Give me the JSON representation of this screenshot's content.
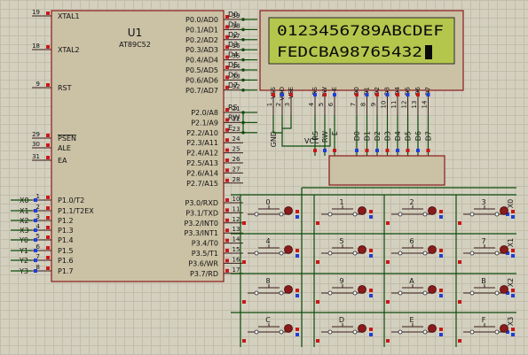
{
  "mcu": {
    "name": "U1",
    "part": "AT89C52",
    "left_pins": [
      {
        "num": "19",
        "name": "XTAL1",
        "net": ""
      },
      {
        "num": "18",
        "name": "XTAL2",
        "net": ""
      },
      {
        "num": "9",
        "name": "RST",
        "net": ""
      },
      {
        "num": "29",
        "name": "PSEN",
        "net": ""
      },
      {
        "num": "30",
        "name": "ALE",
        "net": ""
      },
      {
        "num": "31",
        "name": "EA",
        "net": ""
      },
      {
        "num": "1",
        "name": "P1.0/T2",
        "net": "X0"
      },
      {
        "num": "2",
        "name": "P1.1/T2EX",
        "net": "X1"
      },
      {
        "num": "3",
        "name": "P1.2",
        "net": "X2"
      },
      {
        "num": "4",
        "name": "P1.3",
        "net": "X3"
      },
      {
        "num": "5",
        "name": "P1.4",
        "net": "Y0"
      },
      {
        "num": "6",
        "name": "P1.5",
        "net": "Y1"
      },
      {
        "num": "7",
        "name": "P1.6",
        "net": "Y2"
      },
      {
        "num": "8",
        "name": "P1.7",
        "net": "Y3"
      }
    ],
    "right_pins": [
      {
        "num": "39",
        "name": "P0.0/AD0",
        "net": "D0"
      },
      {
        "num": "38",
        "name": "P0.1/AD1",
        "net": "D1"
      },
      {
        "num": "37",
        "name": "P0.2/AD2",
        "net": "D2"
      },
      {
        "num": "36",
        "name": "P0.3/AD3",
        "net": "D3"
      },
      {
        "num": "35",
        "name": "P0.4/AD4",
        "net": "D4"
      },
      {
        "num": "34",
        "name": "P0.5/AD5",
        "net": "D5"
      },
      {
        "num": "33",
        "name": "P0.6/AD6",
        "net": "D6"
      },
      {
        "num": "32",
        "name": "P0.7/AD7",
        "net": "D7"
      },
      {
        "num": "21",
        "name": "P2.0/A8",
        "net": "RS"
      },
      {
        "num": "22",
        "name": "P2.1/A9",
        "net": "RW"
      },
      {
        "num": "23",
        "name": "P2.2/A10",
        "net": "E"
      },
      {
        "num": "24",
        "name": "P2.3/A11",
        "net": ""
      },
      {
        "num": "25",
        "name": "P2.4/A12",
        "net": ""
      },
      {
        "num": "26",
        "name": "P2.5/A13",
        "net": ""
      },
      {
        "num": "27",
        "name": "P2.6/A14",
        "net": ""
      },
      {
        "num": "28",
        "name": "P2.7/A15",
        "net": ""
      },
      {
        "num": "10",
        "name": "P3.0/RXD",
        "net": ""
      },
      {
        "num": "11",
        "name": "P3.1/TXD",
        "net": ""
      },
      {
        "num": "12",
        "name": "P3.2/INT0",
        "net": ""
      },
      {
        "num": "13",
        "name": "P3.3/INT1",
        "net": ""
      },
      {
        "num": "14",
        "name": "P3.4/T0",
        "net": ""
      },
      {
        "num": "15",
        "name": "P3.5/T1",
        "net": ""
      },
      {
        "num": "16",
        "name": "P3.6/WR",
        "net": ""
      },
      {
        "num": "17",
        "name": "P3.7/RD",
        "net": ""
      }
    ]
  },
  "lcd": {
    "line1": "0123456789ABCDEF",
    "line2": "FEDCBA98765432",
    "pins": [
      {
        "name": "VSS",
        "num": "1"
      },
      {
        "name": "VDD",
        "num": "2"
      },
      {
        "name": "VEE",
        "num": "3"
      },
      {
        "name": "RS",
        "num": "4"
      },
      {
        "name": "RW",
        "num": "5"
      },
      {
        "name": "E",
        "num": "6"
      },
      {
        "name": "D0",
        "num": "7"
      },
      {
        "name": "D1",
        "num": "8"
      },
      {
        "name": "D2",
        "num": "9"
      },
      {
        "name": "D3",
        "num": "10"
      },
      {
        "name": "D4",
        "num": "11"
      },
      {
        "name": "D5",
        "num": "12"
      },
      {
        "name": "D6",
        "num": "13"
      },
      {
        "name": "D7",
        "num": "14"
      }
    ],
    "nets": [
      "GND",
      "",
      "",
      "RS",
      "RW",
      "E",
      "D0",
      "D1",
      "D2",
      "D3",
      "D4",
      "D5",
      "D6",
      "D7"
    ],
    "vcc_label": "VCC"
  },
  "keypad": {
    "keys": [
      "0",
      "1",
      "2",
      "3",
      "4",
      "5",
      "6",
      "7",
      "8",
      "9",
      "A",
      "B",
      "C",
      "D",
      "E",
      "F"
    ],
    "row_nets": [
      "X0",
      "X1",
      "X2",
      "X3"
    ]
  },
  "colors": {
    "wire": "#0b4d0b",
    "chip_fill": "#cbc1a5",
    "chip_border": "#8b1a1a",
    "lcd_screen": "#b5c64d",
    "pin_red": "#c81818",
    "pin_blue": "#1f3fd8",
    "background": "#d4d0c0"
  }
}
